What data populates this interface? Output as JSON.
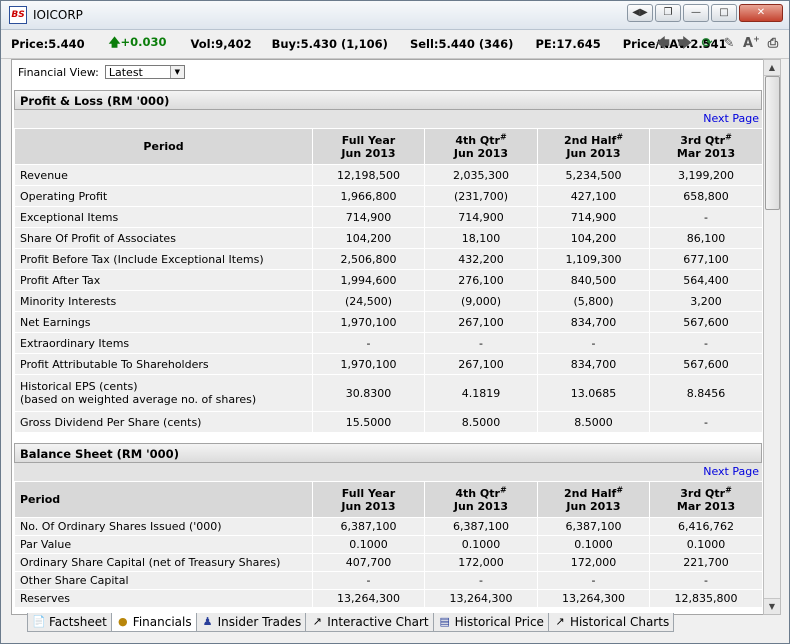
{
  "window": {
    "title": "IOICORP",
    "logo": "BS"
  },
  "quote": {
    "price_label": "Price:",
    "price": "5.440",
    "change": "+0.030",
    "vol_label": "Vol:",
    "vol": "9,402",
    "buy_label": "Buy:",
    "buy": "5.430 (1,106)",
    "sell_label": "Sell:",
    "sell": "5.440 (346)",
    "pe_label": "PE:",
    "pe": "17.645",
    "nav_label": "Price/NAV:",
    "nav": "2.541"
  },
  "financial_view": {
    "label": "Financial View:",
    "selected": "Latest"
  },
  "pl": {
    "title": "Profit & Loss (RM '000)",
    "next_page": "Next Page",
    "period_label": "Period",
    "columns": [
      {
        "l1": "Full Year",
        "sup": "",
        "l2": "Jun 2013"
      },
      {
        "l1": "4th Qtr",
        "sup": "#",
        "l2": "Jun 2013"
      },
      {
        "l1": "2nd Half",
        "sup": "#",
        "l2": "Jun 2013"
      },
      {
        "l1": "3rd Qtr",
        "sup": "#",
        "l2": "Mar 2013"
      }
    ],
    "rows": [
      {
        "label": "Revenue",
        "values": [
          "12,198,500",
          "2,035,300",
          "5,234,500",
          "3,199,200"
        ]
      },
      {
        "label": "Operating Profit",
        "values": [
          "1,966,800",
          "(231,700)",
          "427,100",
          "658,800"
        ]
      },
      {
        "label": "Exceptional Items",
        "values": [
          "714,900",
          "714,900",
          "714,900",
          "-"
        ]
      },
      {
        "label": "Share Of Profit of Associates",
        "values": [
          "104,200",
          "18,100",
          "104,200",
          "86,100"
        ]
      },
      {
        "label": "Profit Before Tax (Include Exceptional Items)",
        "values": [
          "2,506,800",
          "432,200",
          "1,109,300",
          "677,100"
        ]
      },
      {
        "label": "Profit After Tax",
        "values": [
          "1,994,600",
          "276,100",
          "840,500",
          "564,400"
        ]
      },
      {
        "label": "Minority Interests",
        "values": [
          "(24,500)",
          "(9,000)",
          "(5,800)",
          "3,200"
        ]
      },
      {
        "label": "Net Earnings",
        "values": [
          "1,970,100",
          "267,100",
          "834,700",
          "567,600"
        ]
      },
      {
        "label": "Extraordinary Items",
        "values": [
          "-",
          "-",
          "-",
          "-"
        ]
      },
      {
        "label": "Profit Attributable To Shareholders",
        "values": [
          "1,970,100",
          "267,100",
          "834,700",
          "567,600"
        ]
      }
    ],
    "eps": {
      "label1": "Historical EPS (cents)",
      "label2": "(based on weighted average no. of shares)",
      "values": [
        "30.8300",
        "4.1819",
        "13.0685",
        "8.8456"
      ]
    },
    "dividend": {
      "label": "Gross Dividend Per Share (cents)",
      "values": [
        "15.5000",
        "8.5000",
        "8.5000",
        "-"
      ]
    }
  },
  "bs": {
    "title": "Balance Sheet (RM '000)",
    "next_page": "Next Page",
    "period_label": "Period",
    "rows": [
      {
        "label": "No. Of Ordinary Shares Issued ('000)",
        "values": [
          "6,387,100",
          "6,387,100",
          "6,387,100",
          "6,416,762"
        ]
      },
      {
        "label": "Par Value",
        "values": [
          "0.1000",
          "0.1000",
          "0.1000",
          "0.1000"
        ]
      },
      {
        "label": "Ordinary Share Capital (net of Treasury Shares)",
        "values": [
          "407,700",
          "172,000",
          "172,000",
          "221,700"
        ]
      },
      {
        "label": "Other Share Capital",
        "values": [
          "-",
          "-",
          "-",
          "-"
        ]
      },
      {
        "label": "Reserves",
        "values": [
          "13,264,300",
          "13,264,300",
          "13,264,300",
          "12,835,800"
        ]
      }
    ]
  },
  "tabs": [
    {
      "label": "Factsheet",
      "icon": "document-icon"
    },
    {
      "label": "Financials",
      "icon": "coins-icon"
    },
    {
      "label": "Insider Trades",
      "icon": "person-icon"
    },
    {
      "label": "Interactive Chart",
      "icon": "line-chart-icon"
    },
    {
      "label": "Historical Price",
      "icon": "price-list-icon"
    },
    {
      "label": "Historical Charts",
      "icon": "history-chart-icon"
    }
  ]
}
